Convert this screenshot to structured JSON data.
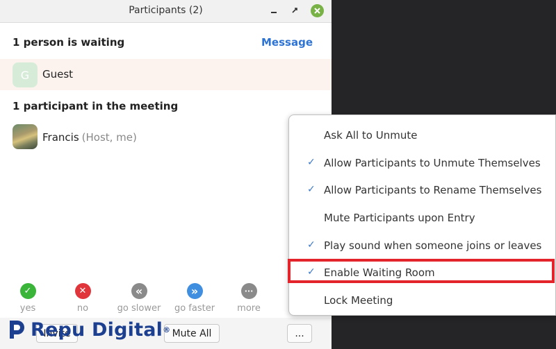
{
  "window": {
    "title": "Participants (2)"
  },
  "waiting": {
    "header": "1 person is waiting",
    "message_label": "Message",
    "guest": {
      "avatar_letter": "G",
      "name": "Guest"
    }
  },
  "meeting": {
    "header": "1 participant in the meeting",
    "participant": {
      "name": "Francis",
      "role": "(Host, me)"
    }
  },
  "feedback": [
    {
      "label": "yes",
      "icon": "check-icon",
      "color": "#3ab53a",
      "glyph": "✓"
    },
    {
      "label": "no",
      "icon": "x-icon",
      "color": "#e0353a",
      "glyph": "✕"
    },
    {
      "label": "go slower",
      "icon": "rewind-icon",
      "color": "#8a8a8a",
      "glyph": "«"
    },
    {
      "label": "go faster",
      "icon": "fast-forward-icon",
      "color": "#3f8ee0",
      "glyph": "»"
    },
    {
      "label": "more",
      "icon": "ellipsis-icon",
      "color": "#8a8a8a",
      "glyph": "···"
    }
  ],
  "bottom": {
    "invite_label": "Invite",
    "mute_all_label": "Mute All",
    "more_label": "..."
  },
  "menu": {
    "items": [
      {
        "label": "Ask All to Unmute",
        "checked": false
      },
      {
        "label": "Allow Participants to Unmute Themselves",
        "checked": true
      },
      {
        "label": "Allow Participants to Rename Themselves",
        "checked": true
      },
      {
        "label": "Mute Participants upon Entry",
        "checked": false
      },
      {
        "label": "Play sound when someone joins or leaves",
        "checked": true
      },
      {
        "label": "Enable Waiting Room",
        "checked": true
      },
      {
        "label": "Lock Meeting",
        "checked": false
      }
    ],
    "check_glyph": "✓"
  },
  "watermark": {
    "text": "Repu Digital",
    "reg": "®",
    "color": "#1d3f8f"
  }
}
